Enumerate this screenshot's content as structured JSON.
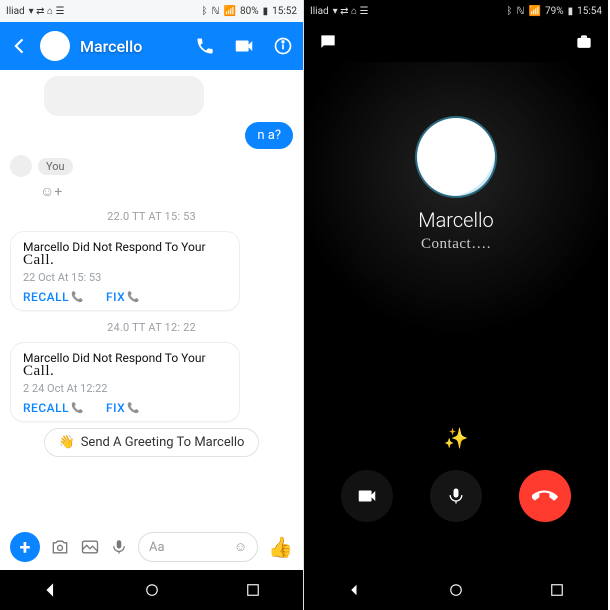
{
  "left": {
    "statusbar": {
      "carrier": "Iliad",
      "signal_icons": "📶",
      "battery": "80%",
      "time": "15:52"
    },
    "header": {
      "name": "Marcello"
    },
    "blue_bubble": "n                        a?",
    "you_label": "You",
    "ts1": "22.0 TT AT 15: 53",
    "ts2": "24.0 TT AT 12: 22",
    "miss1": {
      "line1": "Marcello Did Not Respond To Your",
      "line2": "Call.",
      "time": "22 Oct At 15: 53",
      "action1": "RECALL",
      "action2": "FIX"
    },
    "miss2": {
      "line1": "Marcello Did Not Respond To Your",
      "line2": "Call.",
      "time": "2 24 Oct At 12:22",
      "action1": "RECALL",
      "action2": "FIX"
    },
    "greeting": "Send A Greeting To Marcello",
    "compose_placeholder": "Aa"
  },
  "right": {
    "statusbar": {
      "carrier": "Iliad",
      "battery": "79%",
      "time": "15:54"
    },
    "name": "Marcello",
    "status": "Contact…."
  }
}
